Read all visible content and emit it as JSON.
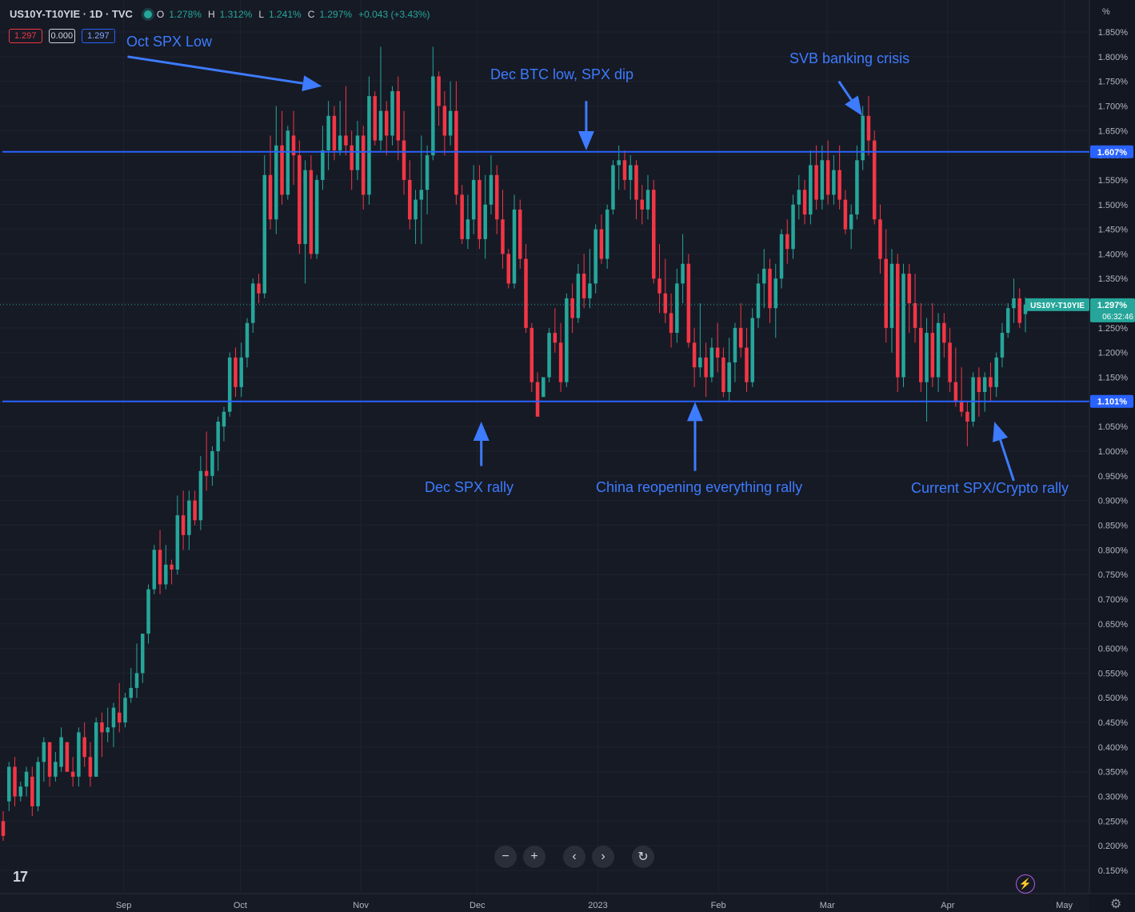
{
  "header": {
    "symbol": "US10Y-T10YIE · 1D · TVC",
    "o_label": "O",
    "o_val": "1.278%",
    "h_label": "H",
    "h_val": "1.312%",
    "l_label": "L",
    "l_val": "1.241%",
    "c_label": "C",
    "c_val": "1.297%",
    "change": "+0.043 (+3.43%)",
    "bid": "1.297",
    "spread": "0.000",
    "ask": "1.297"
  },
  "annotations": {
    "oct_spx_low": "Oct SPX Low",
    "dec_btc_low": "Dec BTC low, SPX dip",
    "svb": "SVB banking crisis",
    "dec_spx_rally": "Dec SPX rally",
    "china": "China reopening everything rally",
    "current": "Current SPX/Crypto rally"
  },
  "price_axis": {
    "unit": "%",
    "ticks": [
      "1.850%",
      "1.800%",
      "1.750%",
      "1.700%",
      "1.650%",
      "1.600%",
      "1.550%",
      "1.500%",
      "1.450%",
      "1.400%",
      "1.350%",
      "1.300%",
      "1.250%",
      "1.200%",
      "1.150%",
      "1.100%",
      "1.050%",
      "1.000%",
      "0.950%",
      "0.900%",
      "0.850%",
      "0.800%",
      "0.750%",
      "0.700%",
      "0.650%",
      "0.600%",
      "0.550%",
      "0.500%",
      "0.450%",
      "0.400%",
      "0.350%",
      "0.300%",
      "0.250%",
      "0.200%",
      "0.150%"
    ],
    "line_labels": [
      "1.607%",
      "1.101%"
    ],
    "symbol_tag": "US10Y-T10YIE",
    "last_price": "1.297%",
    "countdown": "06:32:46"
  },
  "time_axis": {
    "labels": [
      "Sep",
      "Oct",
      "Nov",
      "Dec",
      "2023",
      "Feb",
      "Mar",
      "Apr",
      "May"
    ]
  },
  "controls": {
    "zoom_out": "−",
    "zoom_in": "+",
    "scroll_left": "‹",
    "scroll_right": "›",
    "reset": "↻"
  },
  "logo": "17",
  "colors": {
    "background": "#161a25",
    "up": "#26a69a",
    "down": "#f23645",
    "hline": "#2962ff",
    "annotation": "#3d7bff"
  },
  "chart_data": {
    "type": "candlestick",
    "ylim": [
      0.15,
      1.85
    ],
    "x_start": "2022-08-01",
    "x_end": "2023-04-21",
    "horizontal_lines": [
      1.607,
      1.101
    ],
    "last_price": 1.297,
    "arrows": [
      {
        "from": [
          "2022-09-02",
          1.8
        ],
        "to": [
          "2022-10-22",
          1.74
        ]
      },
      {
        "from": [
          "2022-12-29",
          1.71
        ],
        "to": [
          "2022-12-29",
          1.61
        ]
      },
      {
        "from": [
          "2023-03-04",
          1.75
        ],
        "to": [
          "2023-03-10",
          1.68
        ]
      },
      {
        "from": [
          "2022-12-02",
          0.97
        ],
        "to": [
          "2022-12-02",
          1.06
        ]
      },
      {
        "from": [
          "2023-01-26",
          0.96
        ],
        "to": [
          "2023-01-26",
          1.1
        ]
      },
      {
        "from": [
          "2023-04-18",
          0.94
        ],
        "to": [
          "2023-04-13",
          1.06
        ]
      }
    ],
    "candles": [
      [
        0.25,
        0.27,
        0.21,
        0.22
      ],
      [
        0.29,
        0.37,
        0.27,
        0.36
      ],
      [
        0.36,
        0.38,
        0.28,
        0.3
      ],
      [
        0.3,
        0.33,
        0.29,
        0.32
      ],
      [
        0.32,
        0.36,
        0.3,
        0.35
      ],
      [
        0.34,
        0.36,
        0.26,
        0.28
      ],
      [
        0.28,
        0.38,
        0.27,
        0.37
      ],
      [
        0.37,
        0.42,
        0.33,
        0.41
      ],
      [
        0.41,
        0.41,
        0.32,
        0.34
      ],
      [
        0.34,
        0.39,
        0.33,
        0.37
      ],
      [
        0.36,
        0.44,
        0.35,
        0.42
      ],
      [
        0.41,
        0.41,
        0.35,
        0.35
      ],
      [
        0.35,
        0.38,
        0.32,
        0.34
      ],
      [
        0.34,
        0.44,
        0.32,
        0.43
      ],
      [
        0.42,
        0.45,
        0.36,
        0.38
      ],
      [
        0.38,
        0.41,
        0.32,
        0.34
      ],
      [
        0.34,
        0.46,
        0.34,
        0.45
      ],
      [
        0.45,
        0.47,
        0.38,
        0.43
      ],
      [
        0.43,
        0.48,
        0.41,
        0.44
      ],
      [
        0.44,
        0.49,
        0.4,
        0.48
      ],
      [
        0.47,
        0.53,
        0.43,
        0.45
      ],
      [
        0.45,
        0.51,
        0.44,
        0.5
      ],
      [
        0.5,
        0.56,
        0.49,
        0.52
      ],
      [
        0.52,
        0.61,
        0.5,
        0.55
      ],
      [
        0.55,
        0.63,
        0.53,
        0.63
      ],
      [
        0.63,
        0.73,
        0.61,
        0.72
      ],
      [
        0.72,
        0.81,
        0.71,
        0.8
      ],
      [
        0.8,
        0.84,
        0.71,
        0.73
      ],
      [
        0.73,
        0.81,
        0.72,
        0.77
      ],
      [
        0.77,
        0.78,
        0.73,
        0.76
      ],
      [
        0.76,
        0.91,
        0.75,
        0.87
      ],
      [
        0.87,
        0.92,
        0.8,
        0.83
      ],
      [
        0.83,
        0.92,
        0.8,
        0.9
      ],
      [
        0.9,
        0.92,
        0.85,
        0.86
      ],
      [
        0.86,
        0.99,
        0.84,
        0.96
      ],
      [
        0.96,
        1.04,
        0.92,
        0.95
      ],
      [
        0.95,
        1.01,
        0.93,
        1.0
      ],
      [
        1.0,
        1.07,
        0.96,
        1.06
      ],
      [
        1.05,
        1.09,
        1.02,
        1.08
      ],
      [
        1.08,
        1.2,
        1.07,
        1.19
      ],
      [
        1.19,
        1.21,
        1.11,
        1.13
      ],
      [
        1.13,
        1.22,
        1.11,
        1.19
      ],
      [
        1.19,
        1.27,
        1.17,
        1.26
      ],
      [
        1.26,
        1.35,
        1.24,
        1.34
      ],
      [
        1.34,
        1.36,
        1.3,
        1.32
      ],
      [
        1.32,
        1.6,
        1.31,
        1.56
      ],
      [
        1.56,
        1.64,
        1.45,
        1.47
      ],
      [
        1.47,
        1.7,
        1.44,
        1.62
      ],
      [
        1.62,
        1.69,
        1.5,
        1.52
      ],
      [
        1.52,
        1.66,
        1.51,
        1.65
      ],
      [
        1.64,
        1.69,
        1.54,
        1.6
      ],
      [
        1.6,
        1.63,
        1.4,
        1.42
      ],
      [
        1.42,
        1.59,
        1.34,
        1.57
      ],
      [
        1.57,
        1.6,
        1.39,
        1.4
      ],
      [
        1.4,
        1.56,
        1.39,
        1.55
      ],
      [
        1.55,
        1.66,
        1.53,
        1.61
      ],
      [
        1.61,
        1.71,
        1.57,
        1.68
      ],
      [
        1.68,
        1.7,
        1.59,
        1.61
      ],
      [
        1.61,
        1.71,
        1.6,
        1.64
      ],
      [
        1.64,
        1.74,
        1.6,
        1.62
      ],
      [
        1.62,
        1.65,
        1.53,
        1.57
      ],
      [
        1.57,
        1.67,
        1.55,
        1.64
      ],
      [
        1.64,
        1.66,
        1.49,
        1.52
      ],
      [
        1.52,
        1.76,
        1.5,
        1.72
      ],
      [
        1.72,
        1.73,
        1.62,
        1.63
      ],
      [
        1.63,
        1.82,
        1.61,
        1.69
      ],
      [
        1.69,
        1.71,
        1.6,
        1.64
      ],
      [
        1.64,
        1.74,
        1.62,
        1.73
      ],
      [
        1.73,
        1.76,
        1.59,
        1.63
      ],
      [
        1.63,
        1.69,
        1.52,
        1.55
      ],
      [
        1.55,
        1.59,
        1.45,
        1.47
      ],
      [
        1.47,
        1.53,
        1.42,
        1.51
      ],
      [
        1.51,
        1.64,
        1.42,
        1.53
      ],
      [
        1.53,
        1.62,
        1.48,
        1.6
      ],
      [
        1.6,
        1.82,
        1.59,
        1.76
      ],
      [
        1.76,
        1.77,
        1.66,
        1.7
      ],
      [
        1.7,
        1.73,
        1.6,
        1.64
      ],
      [
        1.64,
        1.75,
        1.62,
        1.69
      ],
      [
        1.69,
        1.75,
        1.5,
        1.52
      ],
      [
        1.52,
        1.54,
        1.42,
        1.43
      ],
      [
        1.43,
        1.52,
        1.41,
        1.47
      ],
      [
        1.47,
        1.58,
        1.44,
        1.55
      ],
      [
        1.55,
        1.58,
        1.41,
        1.43
      ],
      [
        1.43,
        1.56,
        1.39,
        1.5
      ],
      [
        1.5,
        1.6,
        1.48,
        1.56
      ],
      [
        1.56,
        1.58,
        1.44,
        1.47
      ],
      [
        1.47,
        1.53,
        1.37,
        1.4
      ],
      [
        1.4,
        1.41,
        1.33,
        1.34
      ],
      [
        1.34,
        1.52,
        1.33,
        1.49
      ],
      [
        1.49,
        1.51,
        1.37,
        1.39
      ],
      [
        1.39,
        1.42,
        1.24,
        1.25
      ],
      [
        1.25,
        1.26,
        1.12,
        1.14
      ],
      [
        1.14,
        1.16,
        1.08,
        1.07
      ],
      [
        1.11,
        1.15,
        1.11,
        1.15
      ],
      [
        1.15,
        1.25,
        1.14,
        1.24
      ],
      [
        1.24,
        1.29,
        1.2,
        1.22
      ],
      [
        1.22,
        1.26,
        1.12,
        1.14
      ],
      [
        1.14,
        1.32,
        1.13,
        1.31
      ],
      [
        1.31,
        1.34,
        1.24,
        1.27
      ],
      [
        1.27,
        1.38,
        1.26,
        1.36
      ],
      [
        1.36,
        1.4,
        1.29,
        1.31
      ],
      [
        1.31,
        1.41,
        1.29,
        1.34
      ],
      [
        1.34,
        1.46,
        1.32,
        1.45
      ],
      [
        1.45,
        1.48,
        1.38,
        1.39
      ],
      [
        1.39,
        1.5,
        1.37,
        1.49
      ],
      [
        1.49,
        1.59,
        1.48,
        1.58
      ],
      [
        1.58,
        1.62,
        1.53,
        1.59
      ],
      [
        1.59,
        1.61,
        1.53,
        1.55
      ],
      [
        1.55,
        1.6,
        1.51,
        1.58
      ],
      [
        1.58,
        1.59,
        1.47,
        1.51
      ],
      [
        1.51,
        1.54,
        1.46,
        1.49
      ],
      [
        1.49,
        1.56,
        1.47,
        1.53
      ],
      [
        1.53,
        1.55,
        1.34,
        1.35
      ],
      [
        1.35,
        1.42,
        1.28,
        1.32
      ],
      [
        1.32,
        1.39,
        1.26,
        1.28
      ],
      [
        1.28,
        1.32,
        1.21,
        1.24
      ],
      [
        1.24,
        1.37,
        1.22,
        1.34
      ],
      [
        1.34,
        1.44,
        1.3,
        1.38
      ],
      [
        1.38,
        1.4,
        1.21,
        1.22
      ],
      [
        1.22,
        1.25,
        1.13,
        1.17
      ],
      [
        1.17,
        1.3,
        1.15,
        1.19
      ],
      [
        1.19,
        1.22,
        1.11,
        1.15
      ],
      [
        1.15,
        1.23,
        1.14,
        1.21
      ],
      [
        1.21,
        1.26,
        1.16,
        1.19
      ],
      [
        1.19,
        1.21,
        1.11,
        1.12
      ],
      [
        1.12,
        1.23,
        1.1,
        1.18
      ],
      [
        1.18,
        1.26,
        1.14,
        1.25
      ],
      [
        1.25,
        1.3,
        1.19,
        1.21
      ],
      [
        1.21,
        1.25,
        1.12,
        1.14
      ],
      [
        1.14,
        1.29,
        1.13,
        1.27
      ],
      [
        1.27,
        1.36,
        1.25,
        1.34
      ],
      [
        1.34,
        1.41,
        1.29,
        1.37
      ],
      [
        1.37,
        1.39,
        1.26,
        1.29
      ],
      [
        1.29,
        1.38,
        1.23,
        1.35
      ],
      [
        1.35,
        1.45,
        1.33,
        1.44
      ],
      [
        1.44,
        1.47,
        1.38,
        1.41
      ],
      [
        1.41,
        1.52,
        1.39,
        1.5
      ],
      [
        1.5,
        1.56,
        1.47,
        1.53
      ],
      [
        1.53,
        1.55,
        1.46,
        1.48
      ],
      [
        1.48,
        1.61,
        1.46,
        1.58
      ],
      [
        1.58,
        1.62,
        1.49,
        1.51
      ],
      [
        1.51,
        1.62,
        1.49,
        1.59
      ],
      [
        1.59,
        1.63,
        1.5,
        1.52
      ],
      [
        1.52,
        1.6,
        1.5,
        1.57
      ],
      [
        1.57,
        1.62,
        1.49,
        1.51
      ],
      [
        1.51,
        1.53,
        1.44,
        1.45
      ],
      [
        1.45,
        1.5,
        1.41,
        1.48
      ],
      [
        1.48,
        1.62,
        1.47,
        1.59
      ],
      [
        1.59,
        1.7,
        1.57,
        1.68
      ],
      [
        1.68,
        1.72,
        1.6,
        1.63
      ],
      [
        1.63,
        1.65,
        1.46,
        1.47
      ],
      [
        1.47,
        1.5,
        1.36,
        1.39
      ],
      [
        1.39,
        1.45,
        1.22,
        1.25
      ],
      [
        1.25,
        1.41,
        1.2,
        1.38
      ],
      [
        1.38,
        1.4,
        1.12,
        1.15
      ],
      [
        1.15,
        1.38,
        1.13,
        1.36
      ],
      [
        1.36,
        1.38,
        1.24,
        1.3
      ],
      [
        1.3,
        1.36,
        1.22,
        1.25
      ],
      [
        1.25,
        1.3,
        1.12,
        1.14
      ],
      [
        1.14,
        1.27,
        1.06,
        1.24
      ],
      [
        1.24,
        1.3,
        1.13,
        1.15
      ],
      [
        1.15,
        1.28,
        1.12,
        1.26
      ],
      [
        1.26,
        1.28,
        1.19,
        1.22
      ],
      [
        1.22,
        1.25,
        1.12,
        1.14
      ],
      [
        1.14,
        1.21,
        1.09,
        1.1
      ],
      [
        1.1,
        1.17,
        1.07,
        1.08
      ],
      [
        1.08,
        1.1,
        1.01,
        1.06
      ],
      [
        1.06,
        1.16,
        1.05,
        1.15
      ],
      [
        1.15,
        1.17,
        1.07,
        1.12
      ],
      [
        1.12,
        1.16,
        1.08,
        1.15
      ],
      [
        1.15,
        1.18,
        1.1,
        1.13
      ],
      [
        1.13,
        1.2,
        1.11,
        1.19
      ],
      [
        1.19,
        1.26,
        1.17,
        1.24
      ],
      [
        1.24,
        1.3,
        1.23,
        1.29
      ],
      [
        1.29,
        1.35,
        1.26,
        1.31
      ],
      [
        1.31,
        1.33,
        1.25,
        1.26
      ],
      [
        1.278,
        1.312,
        1.241,
        1.297
      ]
    ]
  }
}
